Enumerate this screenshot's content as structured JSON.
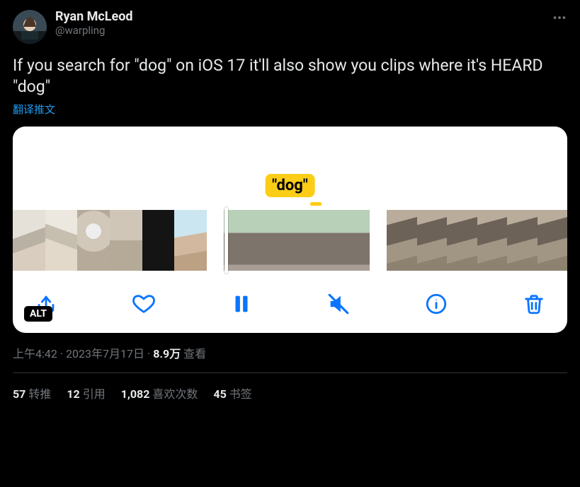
{
  "author": {
    "display_name": "Ryan McLeod",
    "handle": "@warpling"
  },
  "tweet_text": "If you search for \"dog\" on iOS 17 it'll also show you clips where it's HEARD \"dog\"",
  "translate_label": "翻译推文",
  "alt_badge": "ALT",
  "caption_bubble": "\"dog\"",
  "meta": {
    "time": "上午4:42",
    "date": "2023年7月17日",
    "views_number": "8.9万",
    "views_label": "查看"
  },
  "stats": {
    "retweets_n": "57",
    "retweets_label": "转推",
    "quotes_n": "12",
    "quotes_label": "引用",
    "likes_n": "1,082",
    "likes_label": "喜欢次数",
    "bookmarks_n": "45",
    "bookmarks_label": "书签"
  }
}
